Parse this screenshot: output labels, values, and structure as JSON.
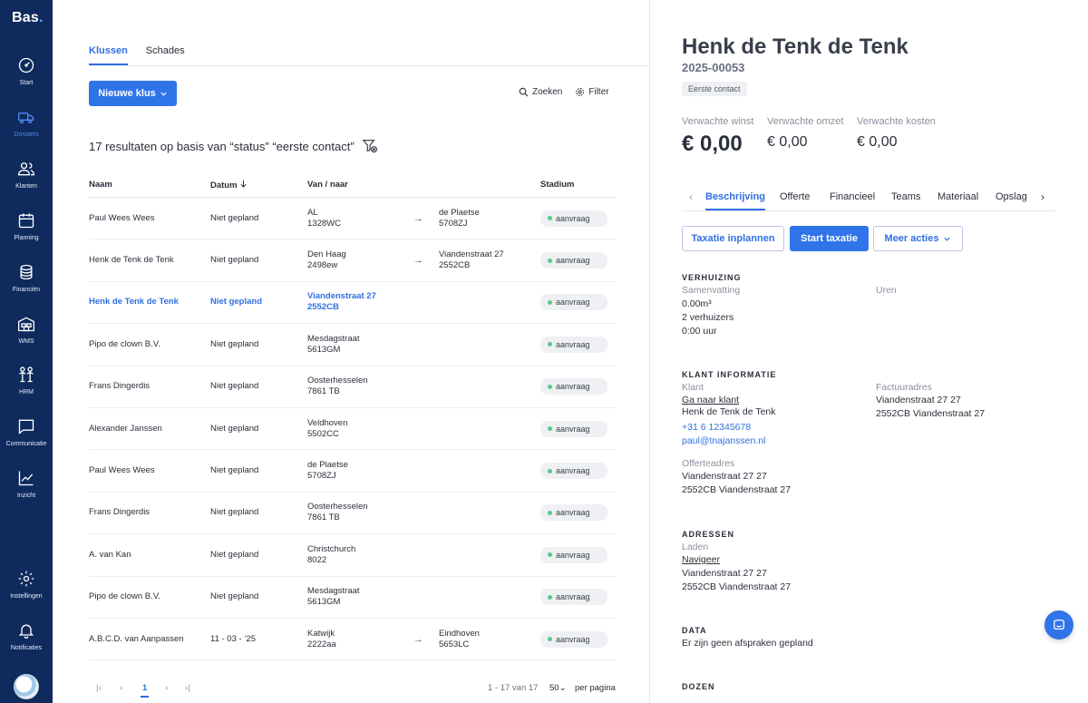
{
  "app": {
    "logo": "Bas"
  },
  "sidebar": {
    "items": [
      {
        "label": "Start",
        "icon": "dashboard-icon"
      },
      {
        "label": "Dossiers",
        "icon": "moving-truck-icon",
        "active": true
      },
      {
        "label": "Klanten",
        "icon": "users-icon"
      },
      {
        "label": "Planning",
        "icon": "calendar-icon"
      },
      {
        "label": "Financiën",
        "icon": "coins-icon"
      },
      {
        "label": "WMS",
        "icon": "warehouse-icon"
      },
      {
        "label": "HRM",
        "icon": "people-icon"
      },
      {
        "label": "Communicatie",
        "icon": "chat-icon"
      },
      {
        "label": "Inzicht",
        "icon": "line-chart-icon"
      }
    ],
    "bottom": [
      {
        "label": "Instellingen",
        "icon": "gear-icon"
      },
      {
        "label": "Notificaties",
        "icon": "bell-icon"
      }
    ]
  },
  "main": {
    "tabs": [
      {
        "label": "Klussen",
        "active": true
      },
      {
        "label": "Schades"
      }
    ],
    "new_button": "Nieuwe klus",
    "search": "Zoeken",
    "filter": "Filter",
    "results_text": "17 resultaten op basis van “status” “eerste contact”",
    "columns": {
      "name": "Naam",
      "date": "Datum",
      "route": "Van / naar",
      "stage": "Stadium"
    },
    "rows": [
      {
        "name": "Paul Wees Wees",
        "date": "Niet gepland",
        "from1": "AL",
        "from2": "1328WC",
        "arrow": "→",
        "to1": "de Plaetse",
        "to2": "5708ZJ",
        "stage": "aanvraag"
      },
      {
        "name": "Henk de Tenk de Tenk",
        "date": "Niet gepland",
        "from1": "Den Haag",
        "from2": "2498ew",
        "arrow": "→",
        "to1": "Viandenstraat 27",
        "to2": "2552CB",
        "stage": "aanvraag"
      },
      {
        "name": "Henk de Tenk de Tenk",
        "date": "Niet gepland",
        "from1": "Viandenstraat 27",
        "from2": "2552CB",
        "arrow": "",
        "to1": "",
        "to2": "",
        "stage": "aanvraag",
        "selected": true
      },
      {
        "name": "Pipo de clown B.V.",
        "date": "Niet gepland",
        "from1": "Mesdagstraat",
        "from2": "5613GM",
        "arrow": "",
        "to1": "",
        "to2": "",
        "stage": "aanvraag"
      },
      {
        "name": "Frans Dingerdis",
        "date": "Niet gepland",
        "from1": "Oosterhesselen",
        "from2": "7861 TB",
        "arrow": "",
        "to1": "",
        "to2": "",
        "stage": "aanvraag"
      },
      {
        "name": "Alexander Janssen",
        "date": "Niet gepland",
        "from1": "Veldhoven",
        "from2": "5502CC",
        "arrow": "",
        "to1": "",
        "to2": "",
        "stage": "aanvraag"
      },
      {
        "name": "Paul Wees Wees",
        "date": "Niet gepland",
        "from1": "de Plaetse",
        "from2": "5708ZJ",
        "arrow": "",
        "to1": "",
        "to2": "",
        "stage": "aanvraag"
      },
      {
        "name": "Frans Dingerdis",
        "date": "Niet gepland",
        "from1": "Oosterhesselen",
        "from2": "7861 TB",
        "arrow": "",
        "to1": "",
        "to2": "",
        "stage": "aanvraag"
      },
      {
        "name": "A. van Kan",
        "date": "Niet gepland",
        "from1": "Christchurch",
        "from2": "8022",
        "arrow": "",
        "to1": "",
        "to2": "",
        "stage": "aanvraag"
      },
      {
        "name": "Pipo de clown B.V.",
        "date": "Niet gepland",
        "from1": "Mesdagstraat",
        "from2": "5613GM",
        "arrow": "",
        "to1": "",
        "to2": "",
        "stage": "aanvraag"
      },
      {
        "name": "A.B.C.D. van Aanpassen",
        "date": "11 - 03 - ‘25",
        "from1": "Katwijk",
        "from2": "2222aa",
        "arrow": "→",
        "to1": "Eindhoven",
        "to2": "5653LC",
        "stage": "aanvraag"
      }
    ],
    "pager": {
      "page": "1",
      "range": "1 - 17 van 17",
      "per_page": "50",
      "per_page_label": "per pagina"
    }
  },
  "detail": {
    "title": "Henk de Tenk de Tenk",
    "number": "2025-00053",
    "status": "Eerste contact",
    "kpis": [
      {
        "label": "Verwachte winst",
        "value": "€ 0,00"
      },
      {
        "label": "Verwachte omzet",
        "value": "€ 0,00"
      },
      {
        "label": "Verwachte kosten",
        "value": "€ 0,00"
      }
    ],
    "tabs": [
      "Beschrijving",
      "Offerte",
      "Financieel",
      "Teams",
      "Materiaal",
      "Opslag"
    ],
    "actions": {
      "plan": "Taxatie inplannen",
      "start": "Start taxatie",
      "more": "Meer acties"
    },
    "verhuizing": {
      "heading": "VERHUIZING",
      "summary_label": "Samenvatting",
      "volume": "0.00m³",
      "movers": "2 verhuizers",
      "hours_text": "0:00 uur",
      "hours_label": "Uren"
    },
    "klant": {
      "heading": "KLANT INFORMATIE",
      "label": "Klant",
      "link": "Ga naar klant",
      "name": "Henk de Tenk de Tenk",
      "phone": "+31 6 12345678",
      "email": "paul@tnajanssen.nl",
      "invoice_label": "Factuuradres",
      "invoice_line1": "Viandenstraat 27 27",
      "invoice_line2": "2552CB Viandenstraat 27",
      "quote_label": "Offerteadres",
      "quote_line1": "Viandenstraat 27 27",
      "quote_line2": "2552CB Viandenstraat 27"
    },
    "adressen": {
      "heading": "ADRESSEN",
      "label": "Laden",
      "link": "Navigeer",
      "line1": "Viandenstraat 27 27",
      "line2": "2552CB Viandenstraat 27"
    },
    "data": {
      "heading": "DATA",
      "text": "Er zijn geen afspraken gepland"
    },
    "dozen": {
      "heading": "DOZEN"
    }
  },
  "colors": {
    "sidebar": "#0f2a5c",
    "accent": "#2f74e8",
    "stage_dot": "#5cc98a"
  }
}
